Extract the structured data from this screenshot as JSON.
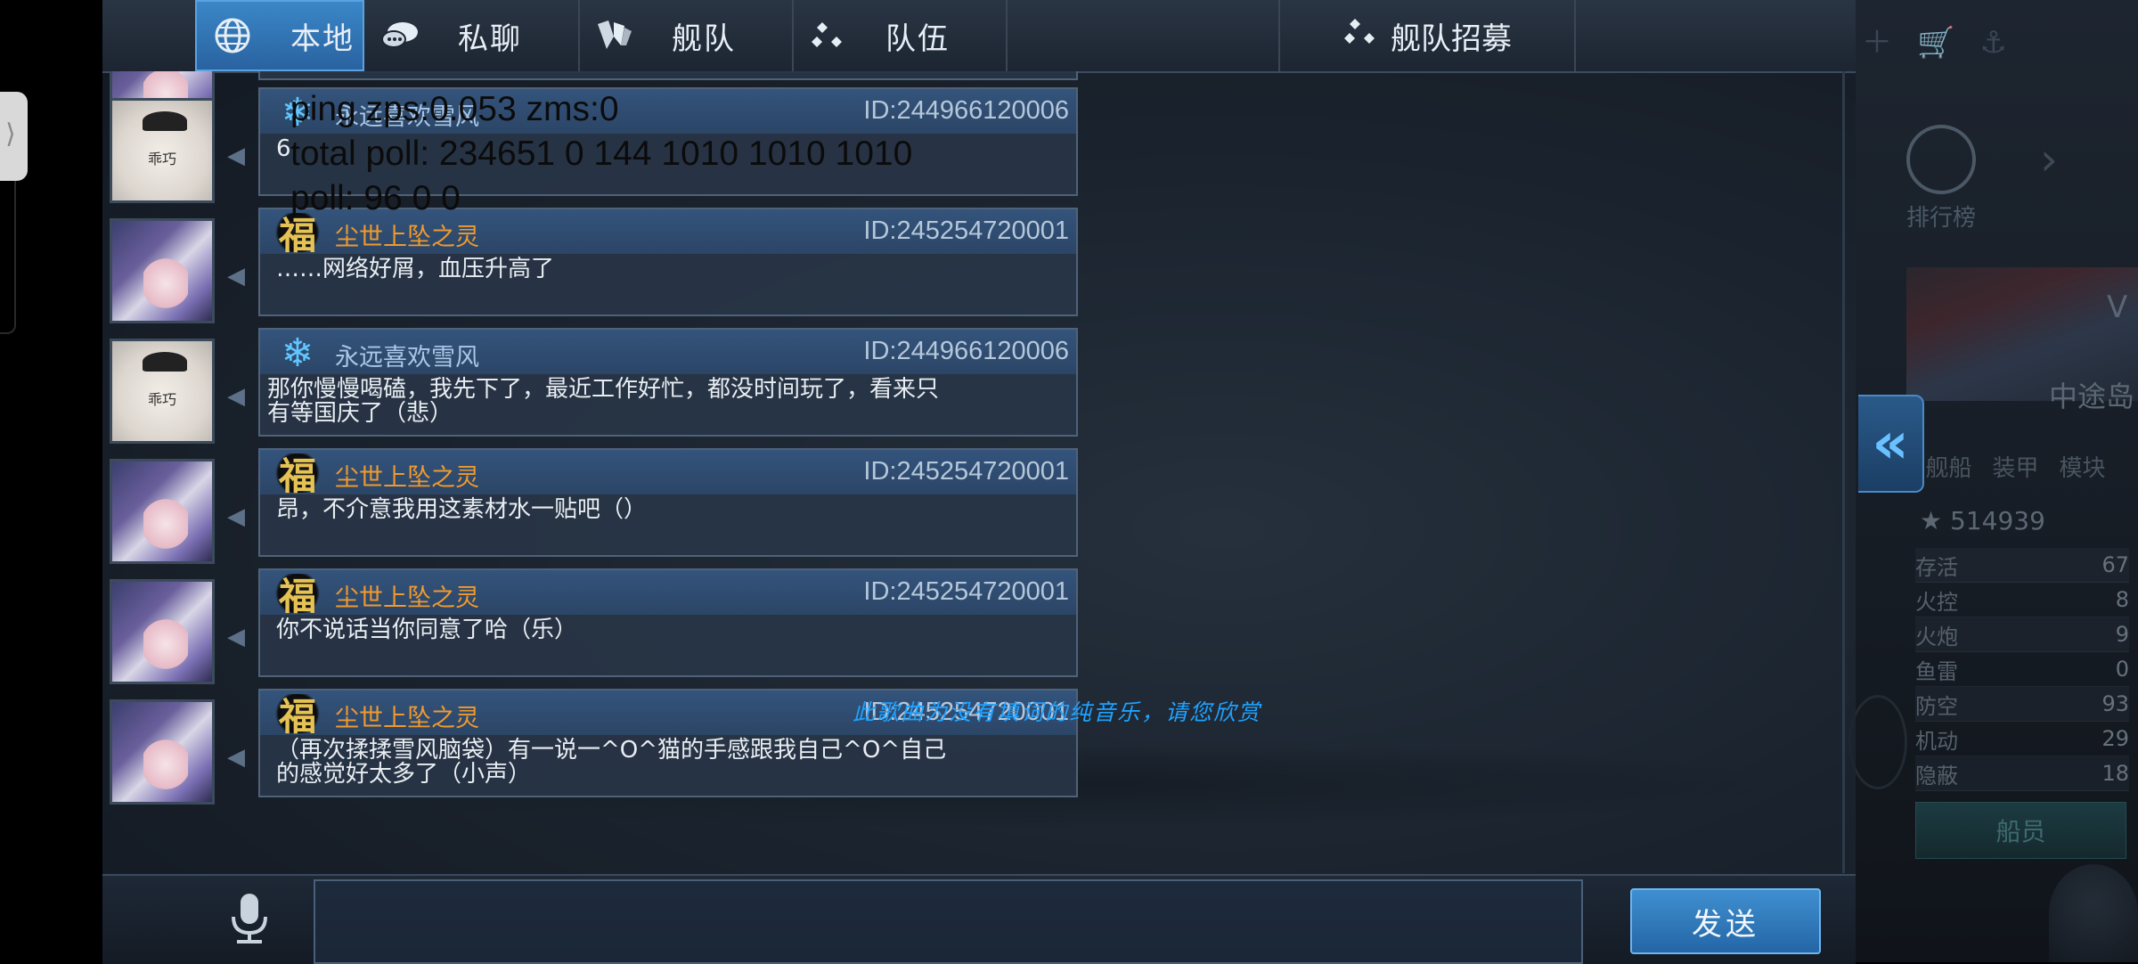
{
  "tabs": [
    {
      "label": "本地",
      "icon": "globe-icon",
      "active": true
    },
    {
      "label": "私聊",
      "icon": "chat-bubble-icon",
      "active": false
    },
    {
      "label": "舰队",
      "icon": "fleet-icon",
      "active": false
    },
    {
      "label": "队伍",
      "icon": "team-icon",
      "active": false
    }
  ],
  "recruit_tab": {
    "label": "舰队招募",
    "icon": "team-icon"
  },
  "messages": [
    {
      "badge": "snow",
      "name": "永远喜欢雪风",
      "id": "ID:244966120006",
      "text": "6",
      "avatar": "cat",
      "avatar_label": "乖巧",
      "name_color": "blue"
    },
    {
      "badge": "fu",
      "name": "尘世上坠之灵",
      "id": "ID:245254720001",
      "text": "……网络好屑，血压升高了",
      "avatar": "girl",
      "name_color": "orange"
    },
    {
      "badge": "snow",
      "name": "永远喜欢雪风",
      "id": "ID:244966120006",
      "text": "那你慢慢喝磕，我先下了，最近工作好忙，都没时间玩了，看来只有等国庆了（悲）",
      "avatar": "cat",
      "avatar_label": "乖巧",
      "name_color": "blue"
    },
    {
      "badge": "fu",
      "name": "尘世上坠之灵",
      "id": "ID:245254720001",
      "text": "昂，不介意我用这素材水一贴吧（）",
      "avatar": "girl",
      "name_color": "orange"
    },
    {
      "badge": "fu",
      "name": "尘世上坠之灵",
      "id": "ID:245254720001",
      "text": "你不说话当你同意了哈（乐）",
      "avatar": "girl",
      "name_color": "orange"
    },
    {
      "badge": "fu",
      "name": "尘世上坠之灵",
      "id": "ID:245254720001",
      "text": "（再次揉揉雪风脑袋）有一说一^O^猫的手感跟我自己^O^自己的感觉好太多了（小声）",
      "avatar": "girl",
      "name_color": "orange"
    }
  ],
  "badge_glyphs": {
    "fu": "福",
    "snow": "❄"
  },
  "debug": {
    "line1": "ping zps:0.053 zms:0",
    "line2": "total poll: 234651 0 144 1010 1010 1010",
    "line3": "poll: 96 0 0"
  },
  "music_notice": "此歌曲为没有填词的纯音乐，请您欣赏",
  "input": {
    "value": "",
    "placeholder": ""
  },
  "send_label": "发送",
  "right_panel": {
    "rank_label": "排行榜",
    "location": "中途岛",
    "tabs": [
      "舰船",
      "装甲",
      "模块"
    ],
    "power": "514939",
    "stats": [
      {
        "label": "存活",
        "value": "67"
      },
      {
        "label": "火控",
        "value": "8"
      },
      {
        "label": "火炮",
        "value": "9"
      },
      {
        "label": "鱼雷",
        "value": "0"
      },
      {
        "label": "防空",
        "value": "93"
      },
      {
        "label": "机动",
        "value": "29"
      },
      {
        "label": "隐蔽",
        "value": "18"
      }
    ],
    "crew_label": "船员"
  },
  "colors": {
    "accent": "#2a62a0",
    "name_orange": "#f09a2e",
    "name_blue": "#a9c7e6",
    "music": "#1fa2ff"
  }
}
